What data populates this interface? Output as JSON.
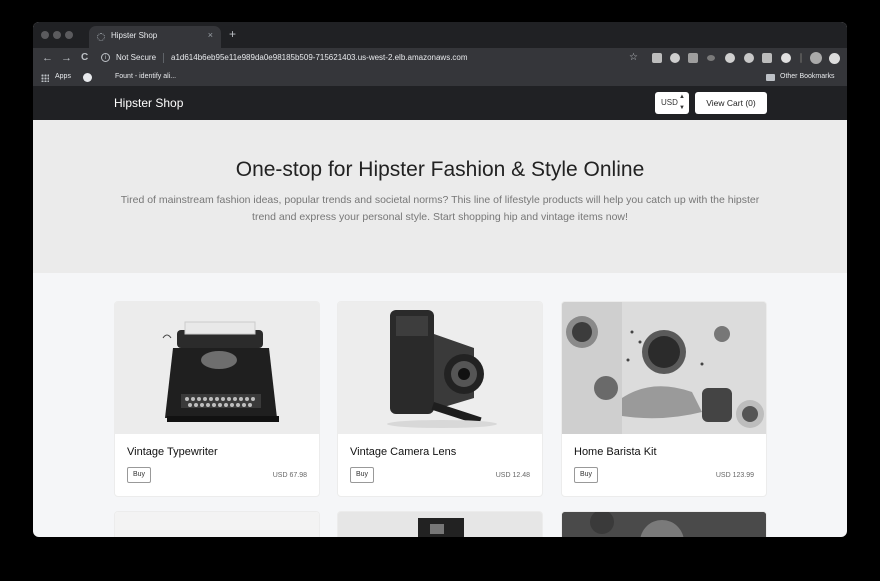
{
  "browser": {
    "tab_title": "Hipster Shop",
    "tab_close": "×",
    "new_tab": "+",
    "back": "←",
    "forward": "→",
    "reload": "C",
    "security_label": "Not Secure",
    "url": "a1d614b6eb95e11e989da0e98185b509-715621403.us-west-2.elb.amazonaws.com",
    "star": "☆",
    "bookmarks": {
      "apps": "Apps",
      "fount": "Fount - identify ali...",
      "other": "Other Bookmarks"
    },
    "extension_colors": [
      "#bdbdbd",
      "#cfcfcf",
      "#9e9e9e",
      "#7a7a7a",
      "#d0d0d0",
      "#c8c8c8",
      "#bcbcbc",
      "#e0e0e0",
      "#aaaaaa",
      "#dddddd"
    ]
  },
  "header": {
    "brand": "Hipster Shop",
    "currency": "USD",
    "currency_arrows": "▲▼",
    "cart_label": "View Cart (0)"
  },
  "hero": {
    "title": "One-stop for Hipster Fashion & Style Online",
    "subtitle": "Tired of mainstream fashion ideas, popular trends and societal norms? This line of lifestyle products will help you catch up with the hipster trend and express your personal style. Start shopping hip and vintage items now!"
  },
  "products": [
    {
      "name": "Vintage Typewriter",
      "buy_label": "Buy",
      "price": "USD 67.98"
    },
    {
      "name": "Vintage Camera Lens",
      "buy_label": "Buy",
      "price": "USD 12.48"
    },
    {
      "name": "Home Barista Kit",
      "buy_label": "Buy",
      "price": "USD 123.99"
    }
  ],
  "colors": {
    "header_bg": "#202124",
    "hero_bg": "#ebebeb",
    "page_bg": "#f5f6f8"
  }
}
